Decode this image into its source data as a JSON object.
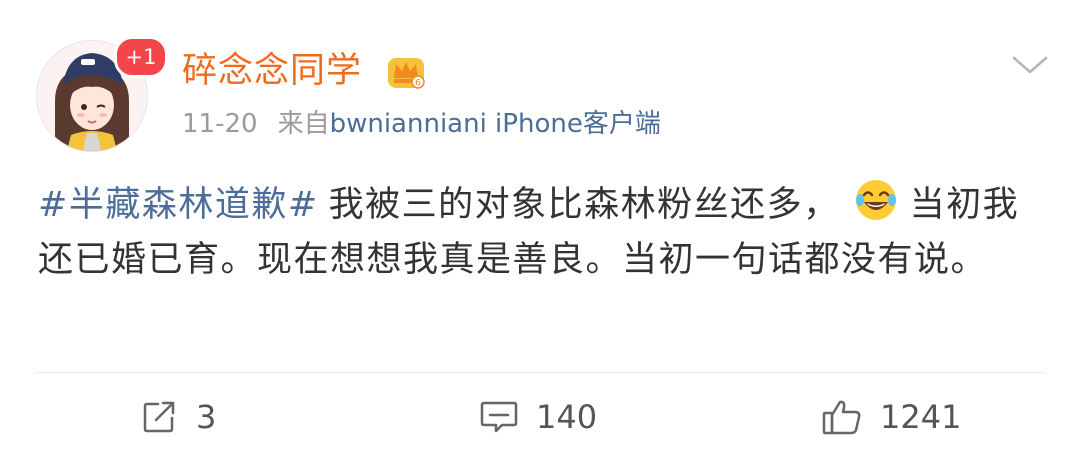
{
  "post": {
    "badge": "+1",
    "username": "碎念念同学",
    "time": "11-20",
    "source_prefix": "来自",
    "client": "bwnianniani iPhone客户端",
    "hashtag": "#半藏森林道歉#",
    "text_part1": "我被三的对象比森林粉丝还多，",
    "text_part2": "当初我还已婚已育。现在想想我真是善良。当初一句话都没有说。"
  },
  "icons": {
    "crown": "crown-vip-icon",
    "chevron": "chevron-down-icon",
    "emoji": "laugh-cry-emoji",
    "repost": "repost-icon",
    "comment": "comment-icon",
    "like": "thumbs-up-icon"
  },
  "actions": {
    "repost_count": "3",
    "comment_count": "140",
    "like_count": "1241"
  },
  "colors": {
    "username": "#f26b1d",
    "link": "#4c6d9a",
    "badge": "#f5454a",
    "text": "#333333",
    "meta": "#9b9b9b"
  }
}
